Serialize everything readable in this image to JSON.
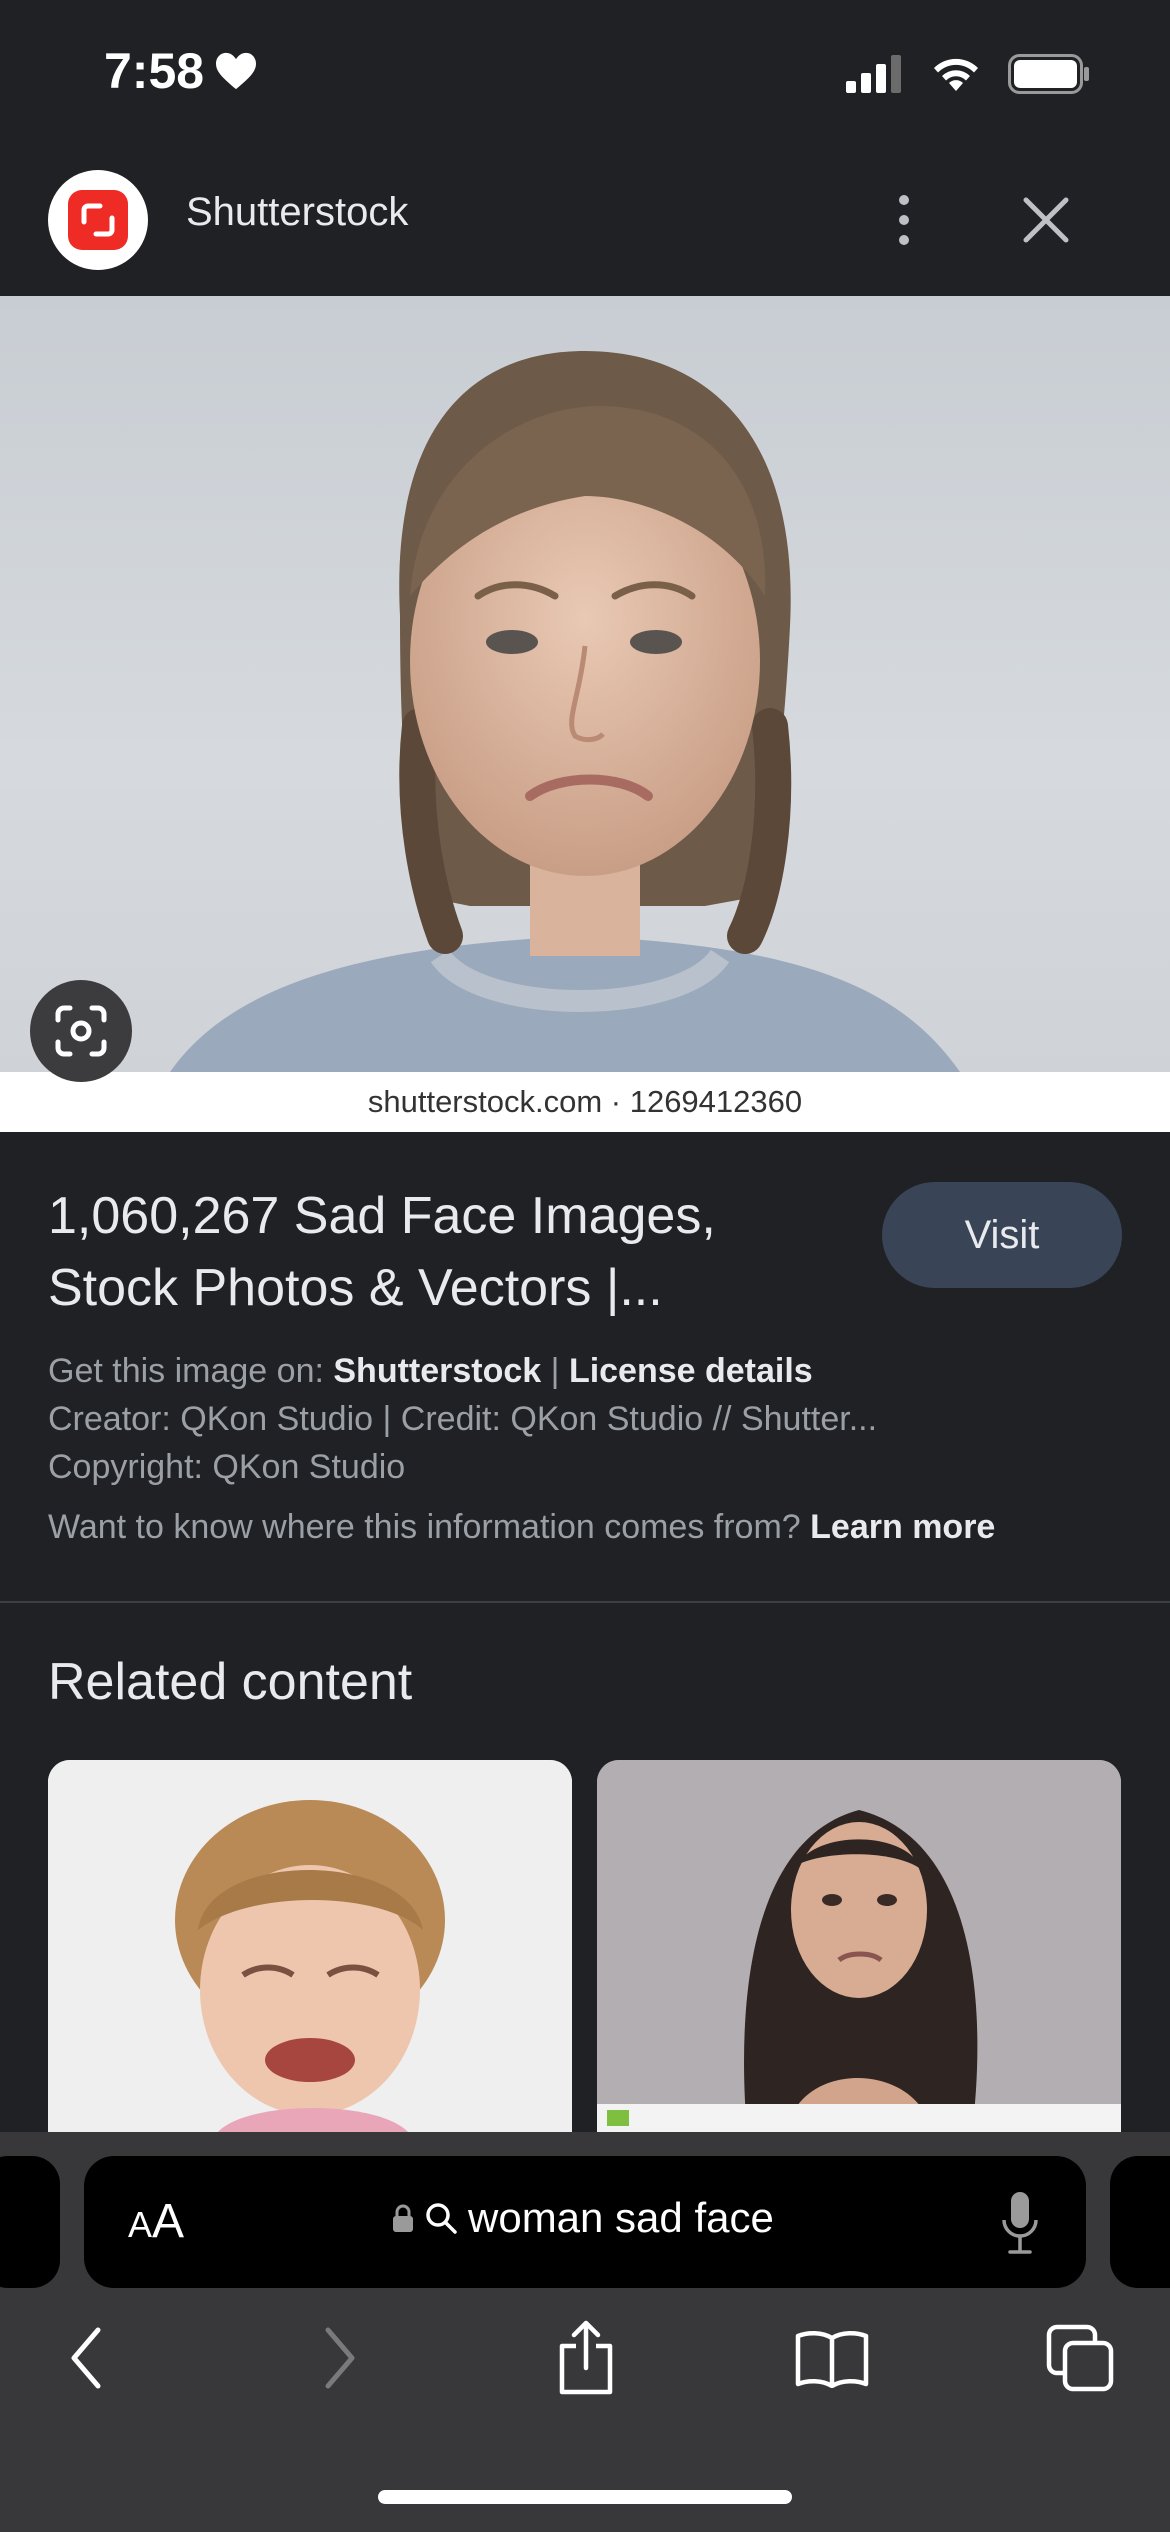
{
  "status_bar": {
    "time": "7:58",
    "heart_icon": "heart-icon",
    "signal_icon": "cellular-signal-icon",
    "wifi_icon": "wifi-icon",
    "battery_icon": "battery-icon"
  },
  "header": {
    "source_name": "Shutterstock",
    "logo_icon": "shutterstock-logo",
    "more_icon": "more-vertical-icon",
    "close_icon": "close-icon"
  },
  "image": {
    "caption": "shutterstock.com · 1269412360",
    "lens_icon": "google-lens-icon"
  },
  "result": {
    "title_line1": "1,060,267 Sad Face Images,",
    "title_line2": "Stock Photos & Vectors |...",
    "visit_label": "Visit",
    "get_image_prefix": "Get this image on: ",
    "get_image_source": "Shutterstock",
    "separator": " | ",
    "license_details": "License details",
    "creator_line": "Creator: QKon Studio | Credit: QKon Studio // Shutter...",
    "copyright_line": "Copyright: QKon Studio",
    "info_question": "Want to know where this information comes from? ",
    "learn_more": "Learn more"
  },
  "related": {
    "title": "Related content"
  },
  "browser": {
    "aa_label_small": "A",
    "aa_label_large": "A",
    "url_text": "woman sad face",
    "lock_icon": "lock-icon",
    "search_icon": "search-icon",
    "mic_icon": "microphone-icon",
    "back_icon": "back-icon",
    "forward_icon": "forward-icon",
    "share_icon": "share-icon",
    "bookmarks_icon": "bookmarks-icon",
    "tabs_icon": "tabs-icon"
  },
  "colors": {
    "background": "#202124",
    "visit_button": "#394457",
    "toolbar": "#38383b",
    "brand_red": "#ee2b24"
  }
}
